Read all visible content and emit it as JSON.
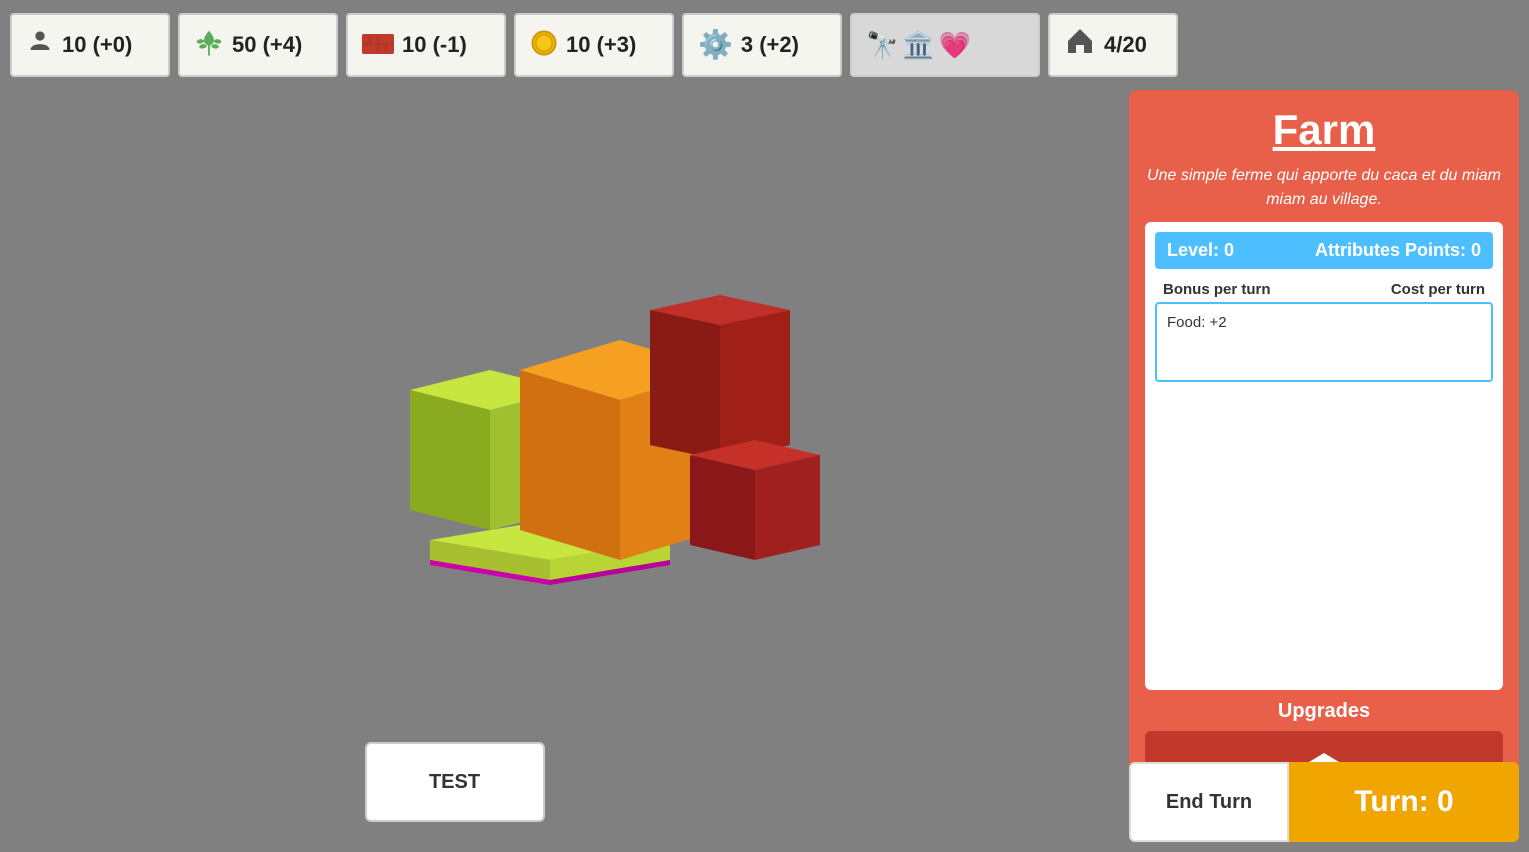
{
  "resources": {
    "population": {
      "value": "10 (+0)",
      "icon": "👤"
    },
    "food": {
      "value": "50 (+4)",
      "icon": "🌾"
    },
    "brick": {
      "value": "10 (-1)",
      "icon": "🧱"
    },
    "gold": {
      "value": "10 (+3)",
      "icon": "🪙"
    },
    "gear": {
      "value": "3 (+2)",
      "icon": "⚙️"
    }
  },
  "tech_icons": [
    "🔭",
    "🏛️",
    "💗"
  ],
  "housing": "4/20",
  "test_button_label": "TEST",
  "panel": {
    "title": "Farm",
    "description": "Une simple ferme qui apporte du caca et du miam miam au village.",
    "level_label": "Level: 0",
    "attributes_label": "Attributes Points: 0",
    "bonus_header": "Bonus  per turn",
    "cost_header": "Cost  per turn",
    "bonus_value": "Food: +2",
    "upgrades_label": "Upgrades"
  },
  "end_turn": {
    "button_label": "End Turn",
    "turn_label": "Turn: 0"
  }
}
